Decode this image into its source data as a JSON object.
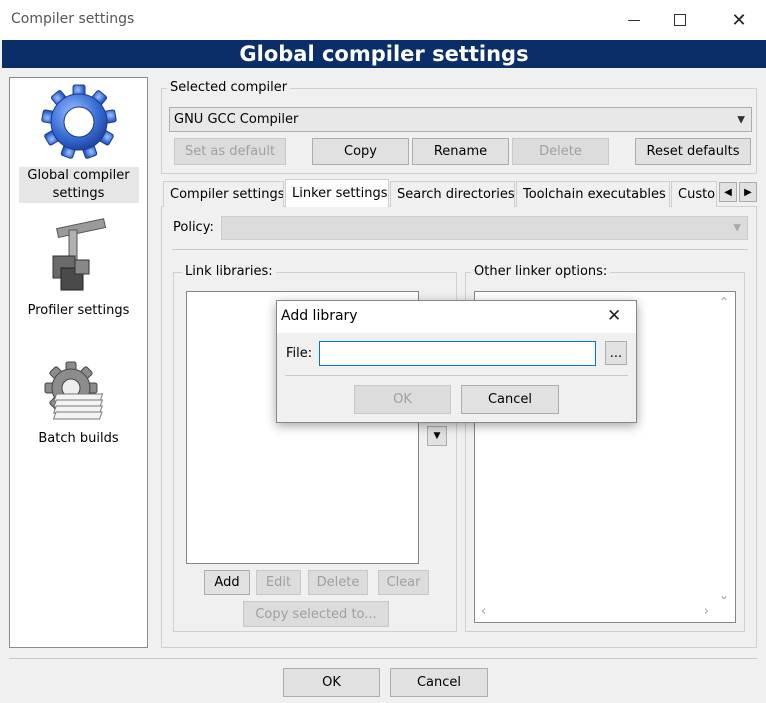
{
  "window": {
    "title": "Compiler settings"
  },
  "banner": {
    "title": "Global compiler settings"
  },
  "categories": [
    {
      "label": "Global compiler settings",
      "icon": "gear-icon",
      "selected": true
    },
    {
      "label": "Profiler settings",
      "icon": "caliper-icon",
      "selected": false
    },
    {
      "label": "Batch builds",
      "icon": "batch-gear-icon",
      "selected": false
    }
  ],
  "compiler": {
    "group_label": "Selected compiler",
    "selected_value": "GNU GCC Compiler",
    "buttons": {
      "set_default": "Set as default",
      "copy": "Copy",
      "rename": "Rename",
      "delete": "Delete",
      "reset_defaults": "Reset defaults"
    }
  },
  "tabs": [
    {
      "label": "Compiler settings",
      "active": false
    },
    {
      "label": "Linker settings",
      "active": true
    },
    {
      "label": "Search directories",
      "active": false
    },
    {
      "label": "Toolchain executables",
      "active": false
    },
    {
      "label": "Custom",
      "active": false
    }
  ],
  "policy": {
    "label": "Policy:",
    "value": ""
  },
  "link_libraries": {
    "label": "Link libraries:",
    "buttons": {
      "add": "Add",
      "edit": "Edit",
      "delete": "Delete",
      "clear": "Clear",
      "copy_selected": "Copy selected to..."
    }
  },
  "other_options": {
    "label": "Other linker options:"
  },
  "footer": {
    "ok": "OK",
    "cancel": "Cancel"
  },
  "add_library_dialog": {
    "title": "Add library",
    "file_label": "File:",
    "file_value": "",
    "browse_label": "...",
    "ok": "OK",
    "cancel": "Cancel"
  }
}
